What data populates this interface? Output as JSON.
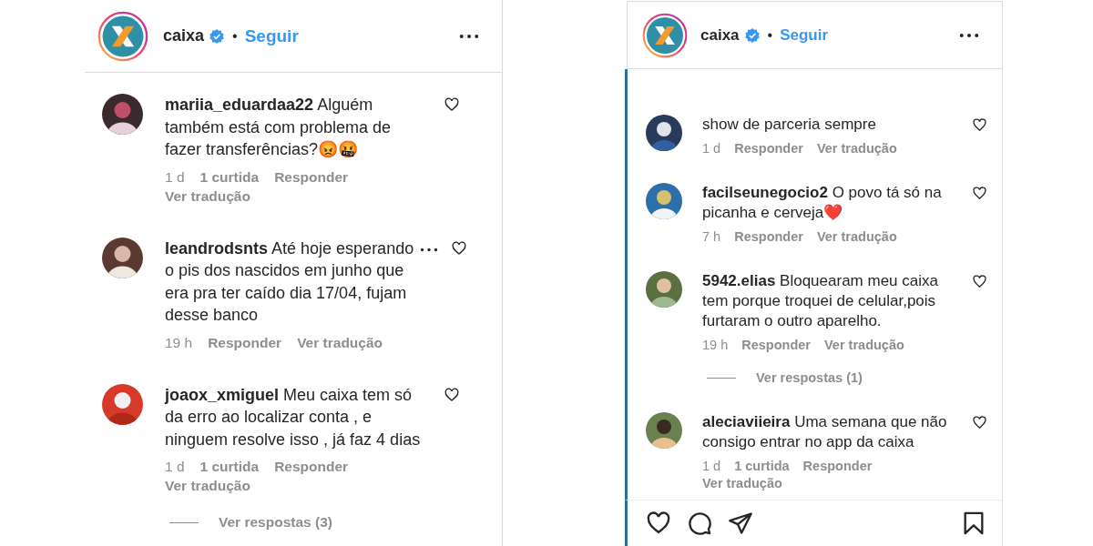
{
  "panels": [
    {
      "header": {
        "account": "caixa",
        "separator": "•",
        "follow": "Seguir"
      },
      "comments": [
        {
          "user": "mariia_eduardaa22",
          "text": "Alguém também está com problema de fazer transferências?😡🤬",
          "time": "1 d",
          "likes": "1 curtida",
          "reply": "Responder",
          "translate": "Ver tradução",
          "options": false
        },
        {
          "user": "leandrodsnts",
          "text": "Até hoje esperando o pis dos nascidos em junho que era pra ter caído dia 17/04, fujam desse banco",
          "time": "19 h",
          "reply": "Responder",
          "translate": "Ver tradução",
          "options": true
        },
        {
          "user": "joaox_xmiguel",
          "text": "Meu caixa tem só da erro ao localizar conta , e ninguem resolve isso , já faz 4 dias",
          "time": "1 d",
          "likes": "1 curtida",
          "reply": "Responder",
          "translate": "Ver tradução",
          "options": false,
          "replies": "Ver respostas (3)"
        }
      ]
    },
    {
      "header": {
        "account": "caixa",
        "separator": "•",
        "follow": "Seguir"
      },
      "action_bar": true,
      "comments": [
        {
          "text": "show de parceria sempre",
          "time": "1 d",
          "reply": "Responder",
          "translate": "Ver tradução",
          "options": false
        },
        {
          "user": "facilseunegocio2",
          "text": "O povo tá só na picanha e cerveja❤️",
          "time": "7 h",
          "reply": "Responder",
          "translate": "Ver tradução",
          "options": false
        },
        {
          "user": "5942.elias",
          "text": "Bloquearam meu caixa tem porque troquei de celular,pois furtaram o outro aparelho.",
          "time": "19 h",
          "reply": "Responder",
          "translate": "Ver tradução",
          "options": false,
          "replies": "Ver respostas (1)"
        },
        {
          "user": "aleciaviieira",
          "text": "Uma semana que não consigo entrar no app da caixa",
          "time": "1 d",
          "likes": "1 curtida",
          "reply": "Responder",
          "translate": "Ver tradução",
          "options": false
        }
      ]
    }
  ]
}
